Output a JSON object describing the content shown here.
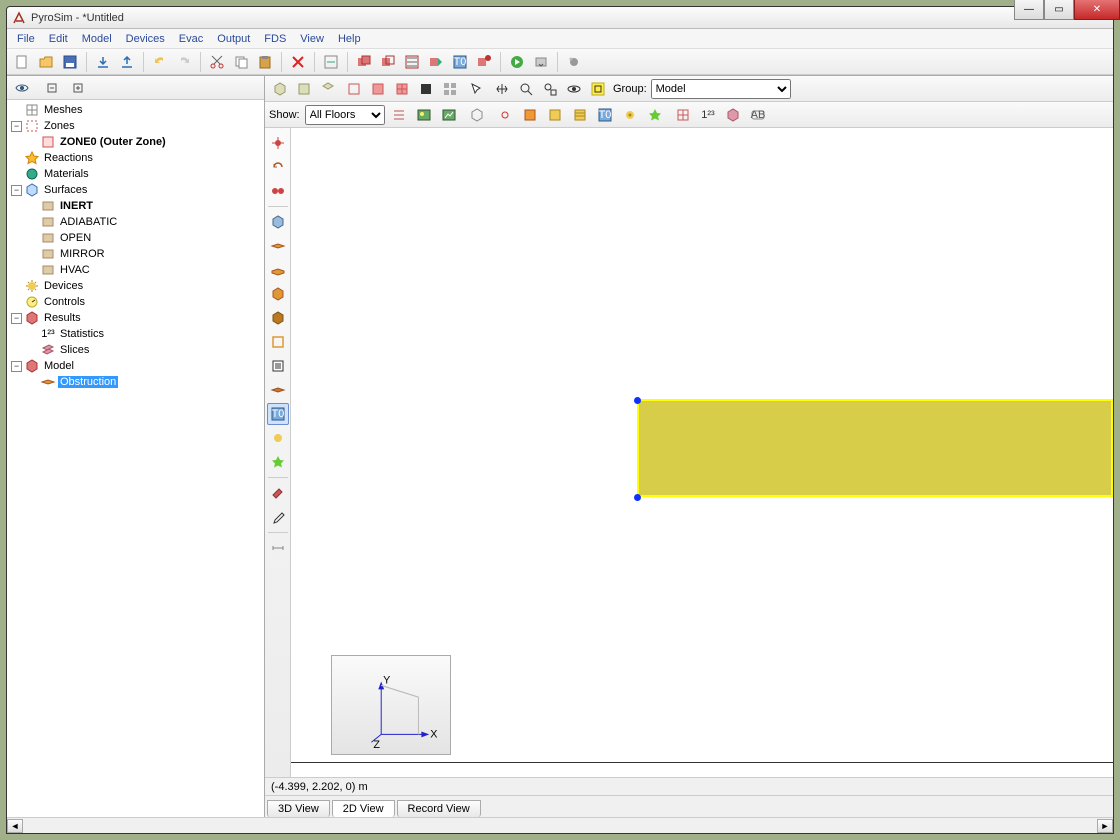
{
  "window": {
    "title": "PyroSim - *Untitled"
  },
  "menu": [
    "File",
    "Edit",
    "Model",
    "Devices",
    "Evac",
    "Output",
    "FDS",
    "View",
    "Help"
  ],
  "toolbar_icons": [
    "new",
    "open",
    "save",
    "import",
    "export",
    "undo",
    "redo",
    "cut",
    "copy",
    "paste",
    "delete",
    "rename-group",
    "add-group",
    "edit-group",
    "properties",
    "snap",
    "text",
    "annotate",
    "run",
    "dropdown",
    "particle"
  ],
  "view_toolbar": {
    "group_label": "Group:",
    "group_select": "Model"
  },
  "show_row": {
    "show_label": "Show:",
    "floors_select": "All Floors"
  },
  "tree": [
    {
      "indent": 0,
      "twisty": "",
      "icon": "mesh-icon",
      "label": "Meshes"
    },
    {
      "indent": 0,
      "twisty": "-",
      "icon": "zone-icon",
      "label": "Zones"
    },
    {
      "indent": 1,
      "twisty": "",
      "icon": "zone-item-icon",
      "label": "ZONE0 (Outer Zone)",
      "bold": true
    },
    {
      "indent": 0,
      "twisty": "",
      "icon": "reaction-icon",
      "label": "Reactions"
    },
    {
      "indent": 0,
      "twisty": "",
      "icon": "material-icon",
      "label": "Materials"
    },
    {
      "indent": 0,
      "twisty": "-",
      "icon": "surface-icon",
      "label": "Surfaces"
    },
    {
      "indent": 1,
      "twisty": "",
      "icon": "surface-item-icon",
      "label": "INERT",
      "bold": true
    },
    {
      "indent": 1,
      "twisty": "",
      "icon": "surface-item-icon",
      "label": "ADIABATIC"
    },
    {
      "indent": 1,
      "twisty": "",
      "icon": "surface-item-icon",
      "label": "OPEN"
    },
    {
      "indent": 1,
      "twisty": "",
      "icon": "surface-item-icon",
      "label": "MIRROR"
    },
    {
      "indent": 1,
      "twisty": "",
      "icon": "surface-item-icon",
      "label": "HVAC"
    },
    {
      "indent": 0,
      "twisty": "",
      "icon": "device-icon",
      "label": "Devices"
    },
    {
      "indent": 0,
      "twisty": "",
      "icon": "control-icon",
      "label": "Controls"
    },
    {
      "indent": 0,
      "twisty": "-",
      "icon": "results-icon",
      "label": "Results"
    },
    {
      "indent": 1,
      "twisty": "",
      "icon": "stats-icon",
      "label": "Statistics"
    },
    {
      "indent": 1,
      "twisty": "",
      "icon": "slices-icon",
      "label": "Slices"
    },
    {
      "indent": 0,
      "twisty": "-",
      "icon": "model-icon",
      "label": "Model"
    },
    {
      "indent": 1,
      "twisty": "",
      "icon": "obstruction-icon",
      "label": "Obstruction",
      "selected": true
    }
  ],
  "status": {
    "coords": "(-4.399, 2.202, 0) m"
  },
  "tabs": {
    "items": [
      "3D View",
      "2D View",
      "Record View"
    ],
    "active": 1
  },
  "triad_labels": {
    "x": "X",
    "y": "Y",
    "z": "Z"
  }
}
